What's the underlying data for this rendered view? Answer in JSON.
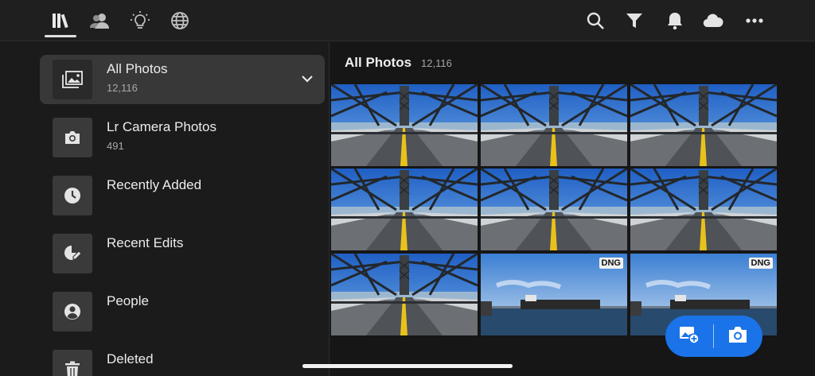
{
  "nav": {
    "tabs": [
      {
        "icon": "library-icon",
        "active": true
      },
      {
        "icon": "people-icon",
        "active": false
      },
      {
        "icon": "lightbulb-icon",
        "active": false
      },
      {
        "icon": "globe-icon",
        "active": false
      }
    ],
    "actions": [
      "search-icon",
      "filter-icon",
      "bell-icon",
      "cloud-icon",
      "more-icon"
    ]
  },
  "sidebar": {
    "items": [
      {
        "label": "All Photos",
        "count": "12,116",
        "icon": "photo-icon",
        "active": true
      },
      {
        "label": "Lr Camera Photos",
        "count": "491",
        "icon": "camera-icon",
        "active": false
      },
      {
        "label": "Recently Added",
        "count": "",
        "icon": "clock-icon",
        "active": false
      },
      {
        "label": "Recent Edits",
        "count": "",
        "icon": "edit-icon",
        "active": false
      },
      {
        "label": "People",
        "count": "",
        "icon": "person-icon",
        "active": false
      },
      {
        "label": "Deleted",
        "count": "",
        "icon": "trash-icon",
        "active": false
      }
    ]
  },
  "main": {
    "title": "All Photos",
    "count": "12,116",
    "photos": [
      {
        "type": "bridge",
        "badge": ""
      },
      {
        "type": "bridge",
        "badge": ""
      },
      {
        "type": "bridge",
        "badge": ""
      },
      {
        "type": "bridge",
        "badge": ""
      },
      {
        "type": "bridge",
        "badge": ""
      },
      {
        "type": "bridge",
        "badge": ""
      },
      {
        "type": "bridge",
        "badge": ""
      },
      {
        "type": "harbor",
        "badge": "DNG"
      },
      {
        "type": "harbor",
        "badge": "DNG"
      }
    ]
  },
  "fab": {
    "actions": [
      "add-photo-icon",
      "camera-icon"
    ]
  },
  "colors": {
    "accent": "#1a73e8",
    "background": "#1b1b1b",
    "active_row": "#383838"
  }
}
